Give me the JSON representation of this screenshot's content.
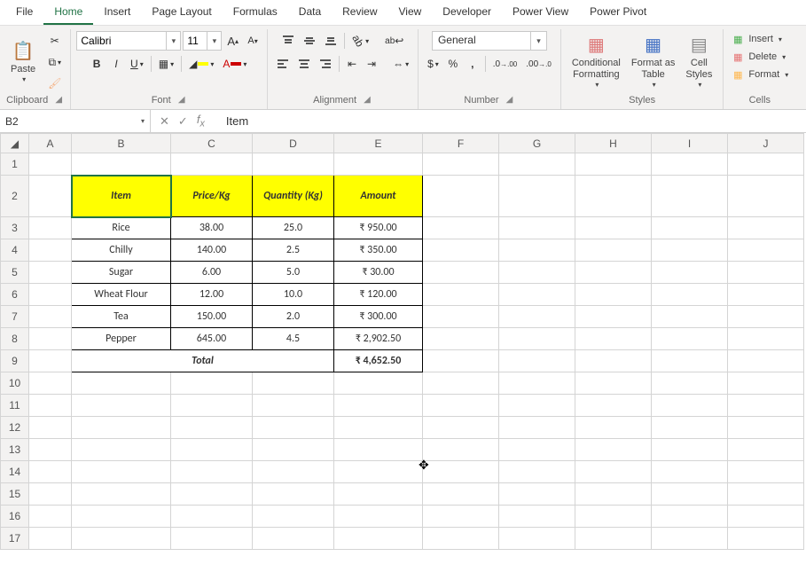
{
  "menu": {
    "tabs": [
      "File",
      "Home",
      "Insert",
      "Page Layout",
      "Formulas",
      "Data",
      "Review",
      "View",
      "Developer",
      "Power View",
      "Power Pivot"
    ],
    "active": "Home"
  },
  "ribbon": {
    "clipboard": {
      "label": "Clipboard",
      "paste": "Paste"
    },
    "font": {
      "label": "Font",
      "name": "Calibri",
      "size": "11",
      "bold": "B",
      "italic": "I",
      "underline": "U"
    },
    "alignment": {
      "label": "Alignment",
      "wrap": "ab"
    },
    "number": {
      "label": "Number",
      "format": "General"
    },
    "styles": {
      "label": "Styles",
      "conditional": "Conditional\nFormatting",
      "formatAs": "Format as\nTable",
      "cellStyles": "Cell\nStyles"
    },
    "cells": {
      "label": "Cells",
      "insert": "Insert",
      "delete": "Delete",
      "format": "Format"
    }
  },
  "namebox": "B2",
  "formula": "Item",
  "columns": [
    "A",
    "B",
    "C",
    "D",
    "E",
    "F",
    "G",
    "H",
    "I",
    "J"
  ],
  "rows": [
    1,
    2,
    3,
    4,
    5,
    6,
    7,
    8,
    9,
    10,
    11,
    12,
    13,
    14,
    15,
    16,
    17
  ],
  "table": {
    "headers": [
      "Item",
      "Price/Kg",
      "Quantity (Kg)",
      "Amount"
    ],
    "rows": [
      {
        "item": "Rice",
        "price": "38.00",
        "qty": "25.0",
        "amount": "₹ 950.00"
      },
      {
        "item": "Chilly",
        "price": "140.00",
        "qty": "2.5",
        "amount": "₹ 350.00"
      },
      {
        "item": "Sugar",
        "price": "6.00",
        "qty": "5.0",
        "amount": "₹ 30.00"
      },
      {
        "item": "Wheat Flour",
        "price": "12.00",
        "qty": "10.0",
        "amount": "₹ 120.00"
      },
      {
        "item": "Tea",
        "price": "150.00",
        "qty": "2.0",
        "amount": "₹ 300.00"
      },
      {
        "item": "Pepper",
        "price": "645.00",
        "qty": "4.5",
        "amount": "₹ 2,902.50"
      }
    ],
    "totalLabel": "Total",
    "totalAmount": "₹ 4,652.50"
  }
}
